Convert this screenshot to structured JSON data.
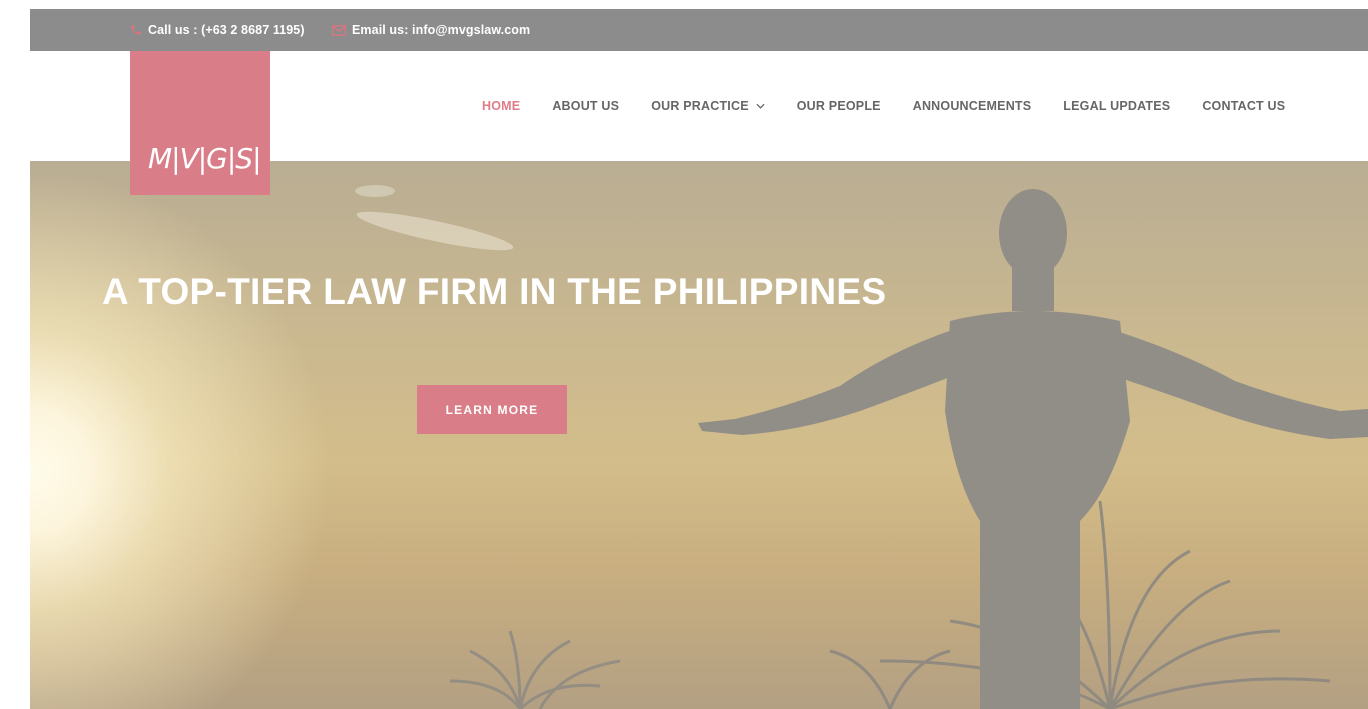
{
  "topbar": {
    "phone_text": "Call us : (+63 2 8687 1195)",
    "email_text": "Email us: info@mvgslaw.com",
    "phone_icon": "phone-icon",
    "email_icon": "envelope-icon"
  },
  "logo": {
    "text": "M|V|G|S|"
  },
  "nav": {
    "items": [
      {
        "label": "HOME",
        "active": true
      },
      {
        "label": "ABOUT US"
      },
      {
        "label": "OUR PRACTICE",
        "has_dropdown": true
      },
      {
        "label": "OUR PEOPLE"
      },
      {
        "label": "ANNOUNCEMENTS"
      },
      {
        "label": "LEGAL UPDATES"
      },
      {
        "label": "CONTACT US"
      }
    ]
  },
  "hero": {
    "title": "A TOP-TIER LAW FIRM IN THE PHILIPPINES",
    "button_label": "LEARN MORE"
  },
  "colors": {
    "accent": "#d97e88",
    "active_nav": "#e07d89",
    "topbar_bg": "#8c8c8c",
    "nav_text": "#666666"
  }
}
